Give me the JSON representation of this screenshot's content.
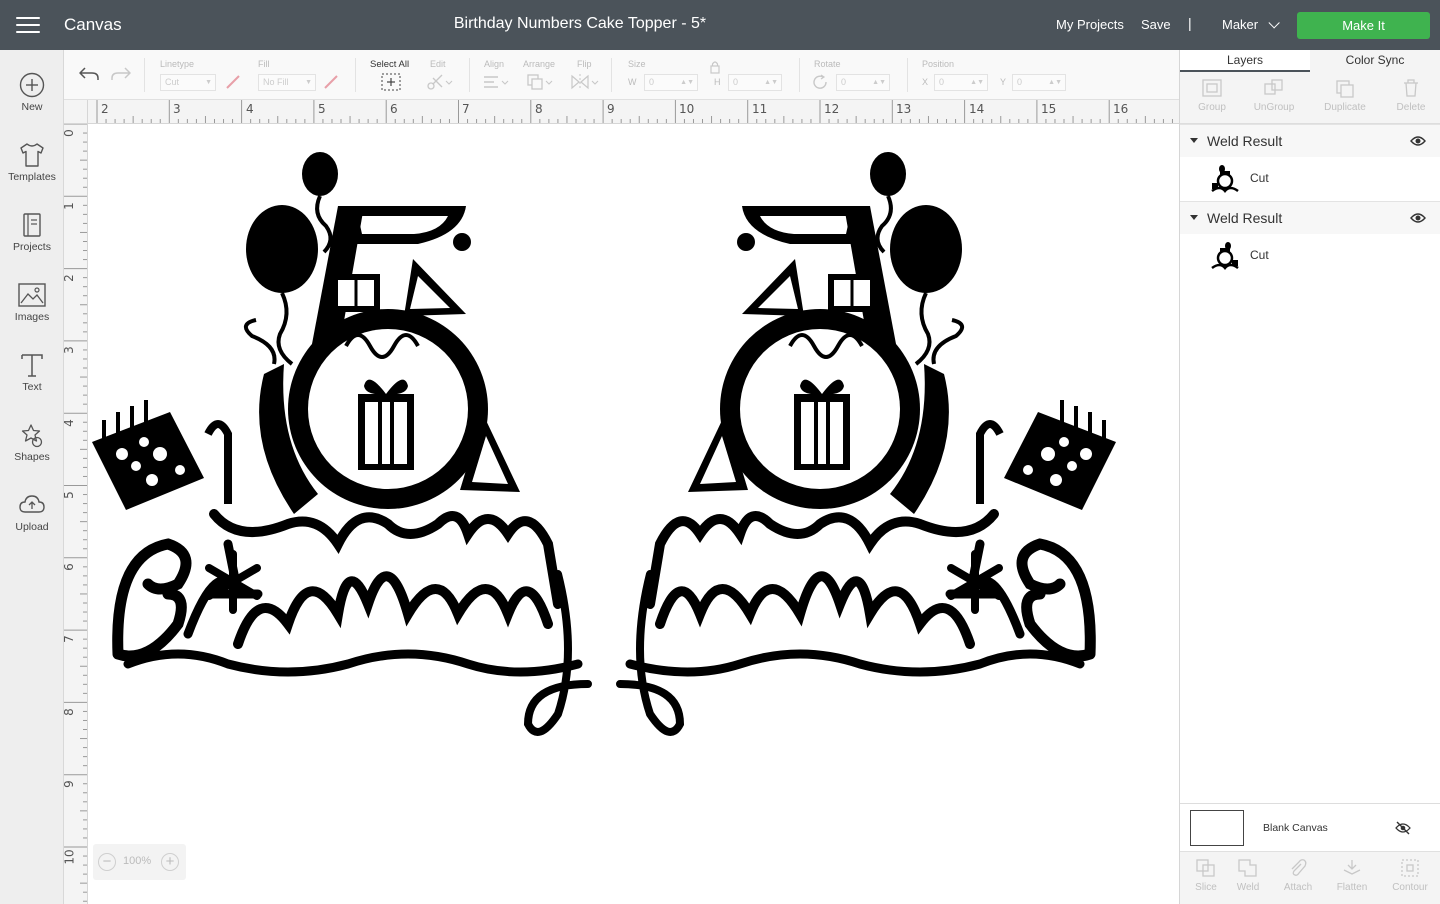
{
  "topbar": {
    "app_name": "Canvas",
    "document_title": "Birthday Numbers Cake Topper - 5*",
    "my_projects": "My Projects",
    "save": "Save",
    "separator": "|",
    "machine": "Maker",
    "make_it": "Make It"
  },
  "colors": {
    "topbar_bg": "#4b535a",
    "make_it_green": "#3fb34f",
    "canvas_bg": "#ffffff"
  },
  "sidebar": {
    "items": [
      {
        "label": "New",
        "icon": "plus-circle-icon"
      },
      {
        "label": "Templates",
        "icon": "tshirt-icon"
      },
      {
        "label": "Projects",
        "icon": "projects-book-icon"
      },
      {
        "label": "Images",
        "icon": "image-icon"
      },
      {
        "label": "Text",
        "icon": "text-t-icon"
      },
      {
        "label": "Shapes",
        "icon": "shapes-icon"
      },
      {
        "label": "Upload",
        "icon": "cloud-upload-icon"
      }
    ]
  },
  "toolbar": {
    "linetype_label": "Linetype",
    "linetype_value": "Cut",
    "fill_label": "Fill",
    "fill_value": "No Fill",
    "select_all": "Select All",
    "edit": "Edit",
    "align": "Align",
    "arrange": "Arrange",
    "flip": "Flip",
    "size": "Size",
    "w_label": "W",
    "w_value": "0",
    "h_label": "H",
    "h_value": "0",
    "rotate": "Rotate",
    "rotate_value": "0",
    "position": "Position",
    "x_label": "X",
    "x_value": "0",
    "y_label": "Y",
    "y_value": "0"
  },
  "ruler": {
    "horizontal": [
      "2",
      "3",
      "4",
      "5",
      "6",
      "7",
      "8",
      "9",
      "10",
      "11",
      "12",
      "13",
      "14",
      "15",
      "16"
    ],
    "vertical": [
      "0",
      "1",
      "2",
      "3",
      "4",
      "5",
      "6",
      "7",
      "8",
      "9",
      "10"
    ]
  },
  "canvas": {
    "zoom": "100%",
    "designs": [
      {
        "text": "Happy Birthday",
        "number": "5",
        "orientation": "normal"
      },
      {
        "text": "Happy Birthday",
        "number": "5",
        "orientation": "mirrored"
      }
    ]
  },
  "panel": {
    "tabs": [
      "Layers",
      "Color Sync"
    ],
    "layer_tools": [
      "Group",
      "UnGroup",
      "Duplicate",
      "Delete"
    ],
    "groups": [
      {
        "name": "Weld Result",
        "layer": "Cut"
      },
      {
        "name": "Weld Result",
        "layer": "Cut"
      }
    ],
    "blank_canvas": "Blank Canvas",
    "bottom_tools": [
      "Slice",
      "Weld",
      "Attach",
      "Flatten",
      "Contour"
    ]
  }
}
